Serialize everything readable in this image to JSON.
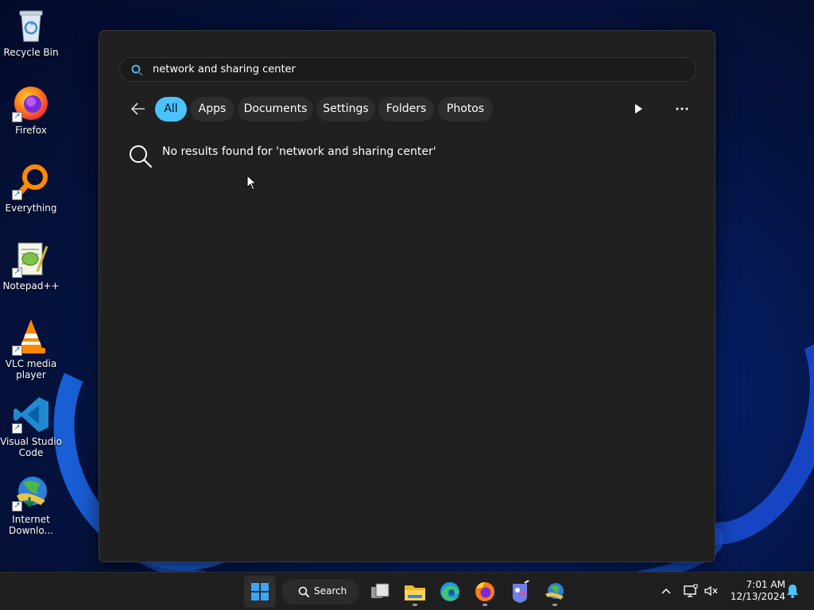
{
  "desktop": {
    "icons": [
      {
        "label": "Recycle Bin",
        "icon": "recycle-bin-icon"
      },
      {
        "label": "Firefox",
        "icon": "firefox-icon"
      },
      {
        "label": "Everything",
        "icon": "everything-search-icon"
      },
      {
        "label": "Notepad++",
        "icon": "notepad-plus-plus-icon"
      },
      {
        "label": "VLC media player",
        "icon": "vlc-icon"
      },
      {
        "label": "Visual Studio Code",
        "icon": "vscode-icon"
      },
      {
        "label": "Internet Downlo...",
        "icon": "internet-download-manager-icon"
      }
    ]
  },
  "search_panel": {
    "query": "network and sharing center",
    "filters": [
      "All",
      "Apps",
      "Documents",
      "Settings",
      "Folders",
      "Photos"
    ],
    "active_filter": "All",
    "no_results_message": "No results found for 'network and sharing center'"
  },
  "taskbar": {
    "search_label": "Search",
    "apps": [
      "start-icon",
      "task-view-icon",
      "file-explorer-icon",
      "edge-icon",
      "firefox-icon",
      "app-icon",
      "internet-download-manager-icon"
    ],
    "clock": {
      "time": "7:01 AM",
      "date": "12/13/2024"
    }
  },
  "colors": {
    "accent": "#4cc2ff",
    "panel_bg": "#202020",
    "taskbar_bg": "#1f1f1f"
  }
}
